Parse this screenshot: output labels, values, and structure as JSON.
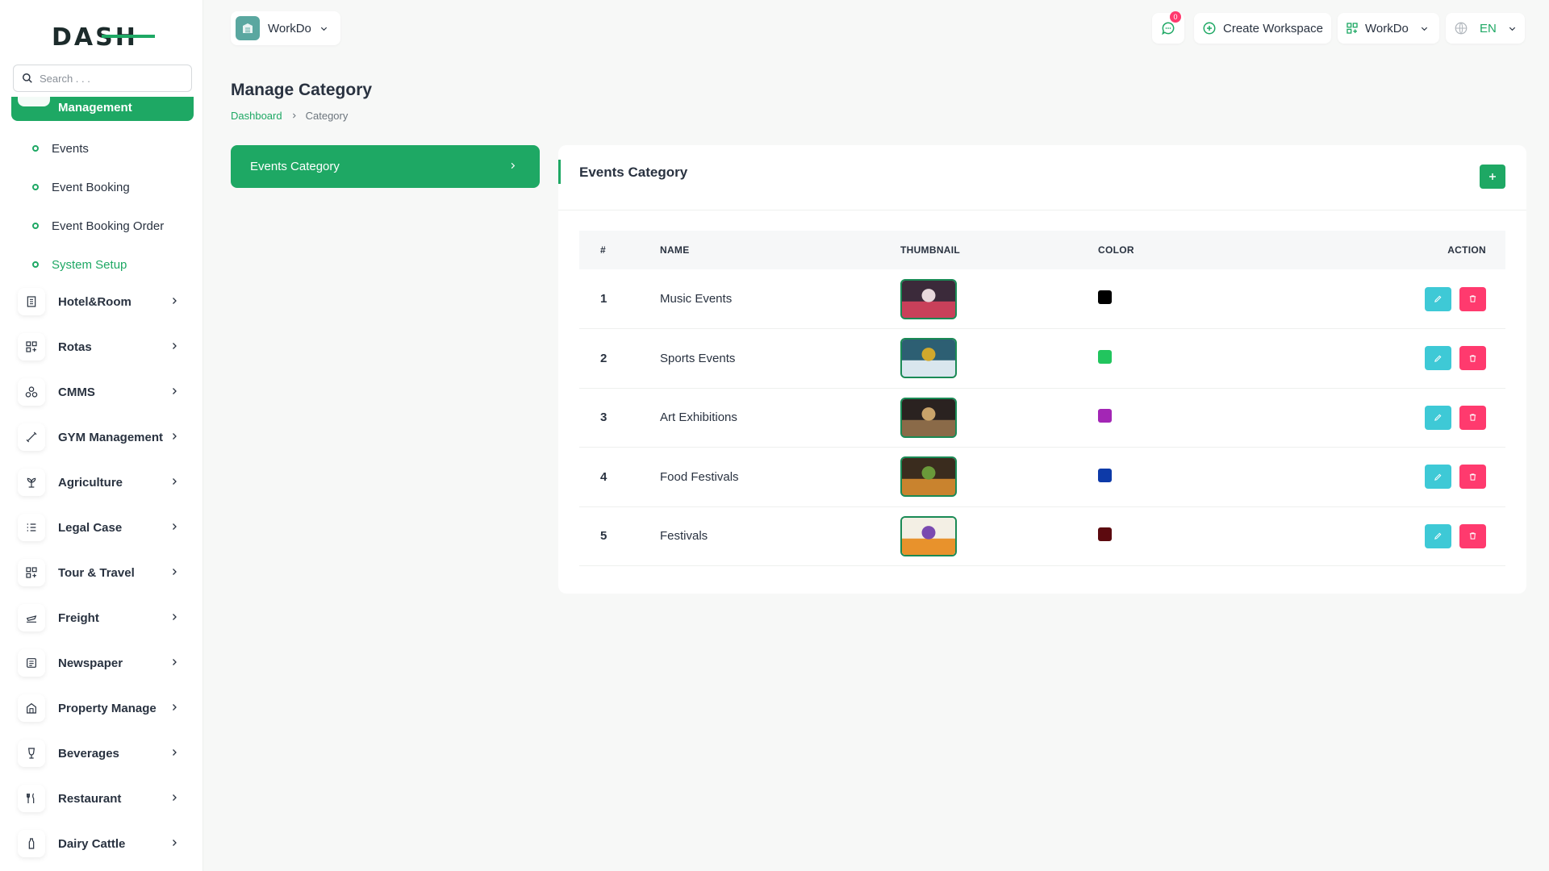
{
  "brand": {
    "logo_text": "DASH"
  },
  "search": {
    "placeholder": "Search . . ."
  },
  "sidebar": {
    "active_module": "Management",
    "submenu": [
      {
        "label": "Events",
        "active": false
      },
      {
        "label": "Event Booking",
        "active": false
      },
      {
        "label": "Event Booking Order",
        "active": false
      },
      {
        "label": "System Setup",
        "active": true
      }
    ],
    "items": [
      {
        "label": "Hotel&Room",
        "icon": "building-icon"
      },
      {
        "label": "Rotas",
        "icon": "grid-icon"
      },
      {
        "label": "CMMS",
        "icon": "circles-icon"
      },
      {
        "label": "GYM Management",
        "icon": "dumbbell-icon"
      },
      {
        "label": "Agriculture",
        "icon": "plant-icon"
      },
      {
        "label": "Legal Case",
        "icon": "list-icon"
      },
      {
        "label": "Tour & Travel",
        "icon": "grid-plus-icon"
      },
      {
        "label": "Freight",
        "icon": "plane-icon"
      },
      {
        "label": "Newspaper",
        "icon": "newspaper-icon"
      },
      {
        "label": "Property Manage",
        "icon": "property-icon"
      },
      {
        "label": "Beverages",
        "icon": "glass-icon"
      },
      {
        "label": "Restaurant",
        "icon": "cutlery-icon"
      },
      {
        "label": "Dairy Cattle",
        "icon": "bottle-icon"
      }
    ]
  },
  "topbar": {
    "workspace": "WorkDo",
    "notification_count": "0",
    "create_workspace": "Create Workspace",
    "current_workspace": "WorkDo",
    "language": "EN"
  },
  "page": {
    "title": "Manage Category",
    "breadcrumb": {
      "home": "Dashboard",
      "current": "Category"
    }
  },
  "tab": {
    "label": "Events Category"
  },
  "card": {
    "title": "Events Category",
    "columns": {
      "num": "#",
      "name": "NAME",
      "thumbnail": "THUMBNAIL",
      "color": "COLOR",
      "action": "ACTION"
    },
    "rows": [
      {
        "num": "1",
        "name": "Music Events",
        "color": "#000000",
        "thumb_colors": [
          "#3b2a3a",
          "#c9405a",
          "#e8d8dc"
        ]
      },
      {
        "num": "2",
        "name": "Sports Events",
        "color": "#22c55e",
        "thumb_colors": [
          "#2d5f73",
          "#d9e6ee",
          "#d1a82c"
        ]
      },
      {
        "num": "3",
        "name": "Art Exhibitions",
        "color": "#a326b5",
        "thumb_colors": [
          "#2a2220",
          "#8a6a48",
          "#c9a36a"
        ]
      },
      {
        "num": "4",
        "name": "Food Festivals",
        "color": "#0d3aa8",
        "thumb_colors": [
          "#3a2c1e",
          "#c9832e",
          "#6a9a3a"
        ]
      },
      {
        "num": "5",
        "name": "Festivals",
        "color": "#5c0a0f",
        "thumb_colors": [
          "#f3efe4",
          "#e8922c",
          "#7a4ab0"
        ]
      }
    ]
  },
  "colors": {
    "accent": "#1ea864",
    "edit": "#3ec9d6",
    "delete": "#ff3a6e"
  }
}
